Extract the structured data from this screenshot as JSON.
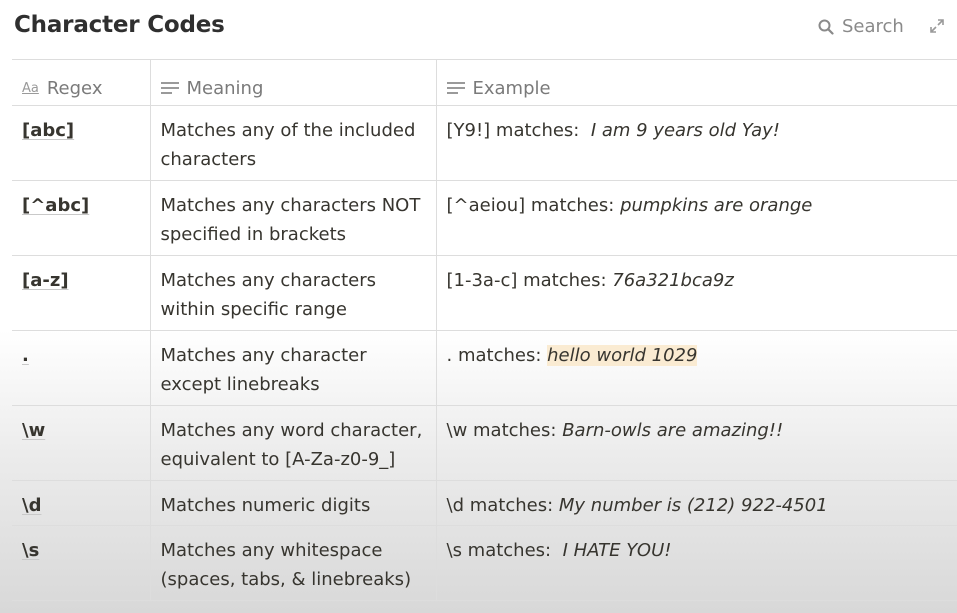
{
  "page": {
    "title": "Character Codes",
    "search_label": "Search"
  },
  "columns": [
    {
      "label": "Regex",
      "icon": "title-property-icon"
    },
    {
      "label": "Meaning",
      "icon": "text-property-icon"
    },
    {
      "label": "Example",
      "icon": "text-property-icon"
    }
  ],
  "rows": [
    {
      "regex": "[abc]",
      "meaning": "Matches any of the included characters",
      "example_prefix": "[Y9!] matches:",
      "example_text": "I am 9 years old Yay!"
    },
    {
      "regex": "[^abc]",
      "meaning": "Matches any characters NOT specified in brackets",
      "example_prefix": "[^aeiou] matches:",
      "example_text": "pumpkins are orange"
    },
    {
      "regex": "[a-z]",
      "meaning": "Matches any characters within specific range",
      "example_prefix": "[1-3a-c] matches:",
      "example_text": "76a321bca9z"
    },
    {
      "regex": ".",
      "meaning": "Matches any character except linebreaks",
      "example_prefix": ". matches:",
      "example_text": "hello world 1029"
    },
    {
      "regex": "\\w",
      "meaning": "Matches any word character, equivalent to [A-Za-z0-9_]",
      "example_prefix": "\\w matches:",
      "example_text": "Barn-owls are amazing!!"
    },
    {
      "regex": "\\d",
      "meaning": "Matches numeric digits",
      "example_prefix": "\\d matches:",
      "example_text": "My number is (212) 922-4501"
    },
    {
      "regex": "\\s",
      "meaning": "Matches any whitespace (spaces, tabs, & linebreaks)",
      "example_prefix": "\\s matches:",
      "example_text": "I HATE YOU!"
    }
  ],
  "colors": {
    "highlight": "#faebd2",
    "border": "#dddddd",
    "text": "#37352f"
  }
}
